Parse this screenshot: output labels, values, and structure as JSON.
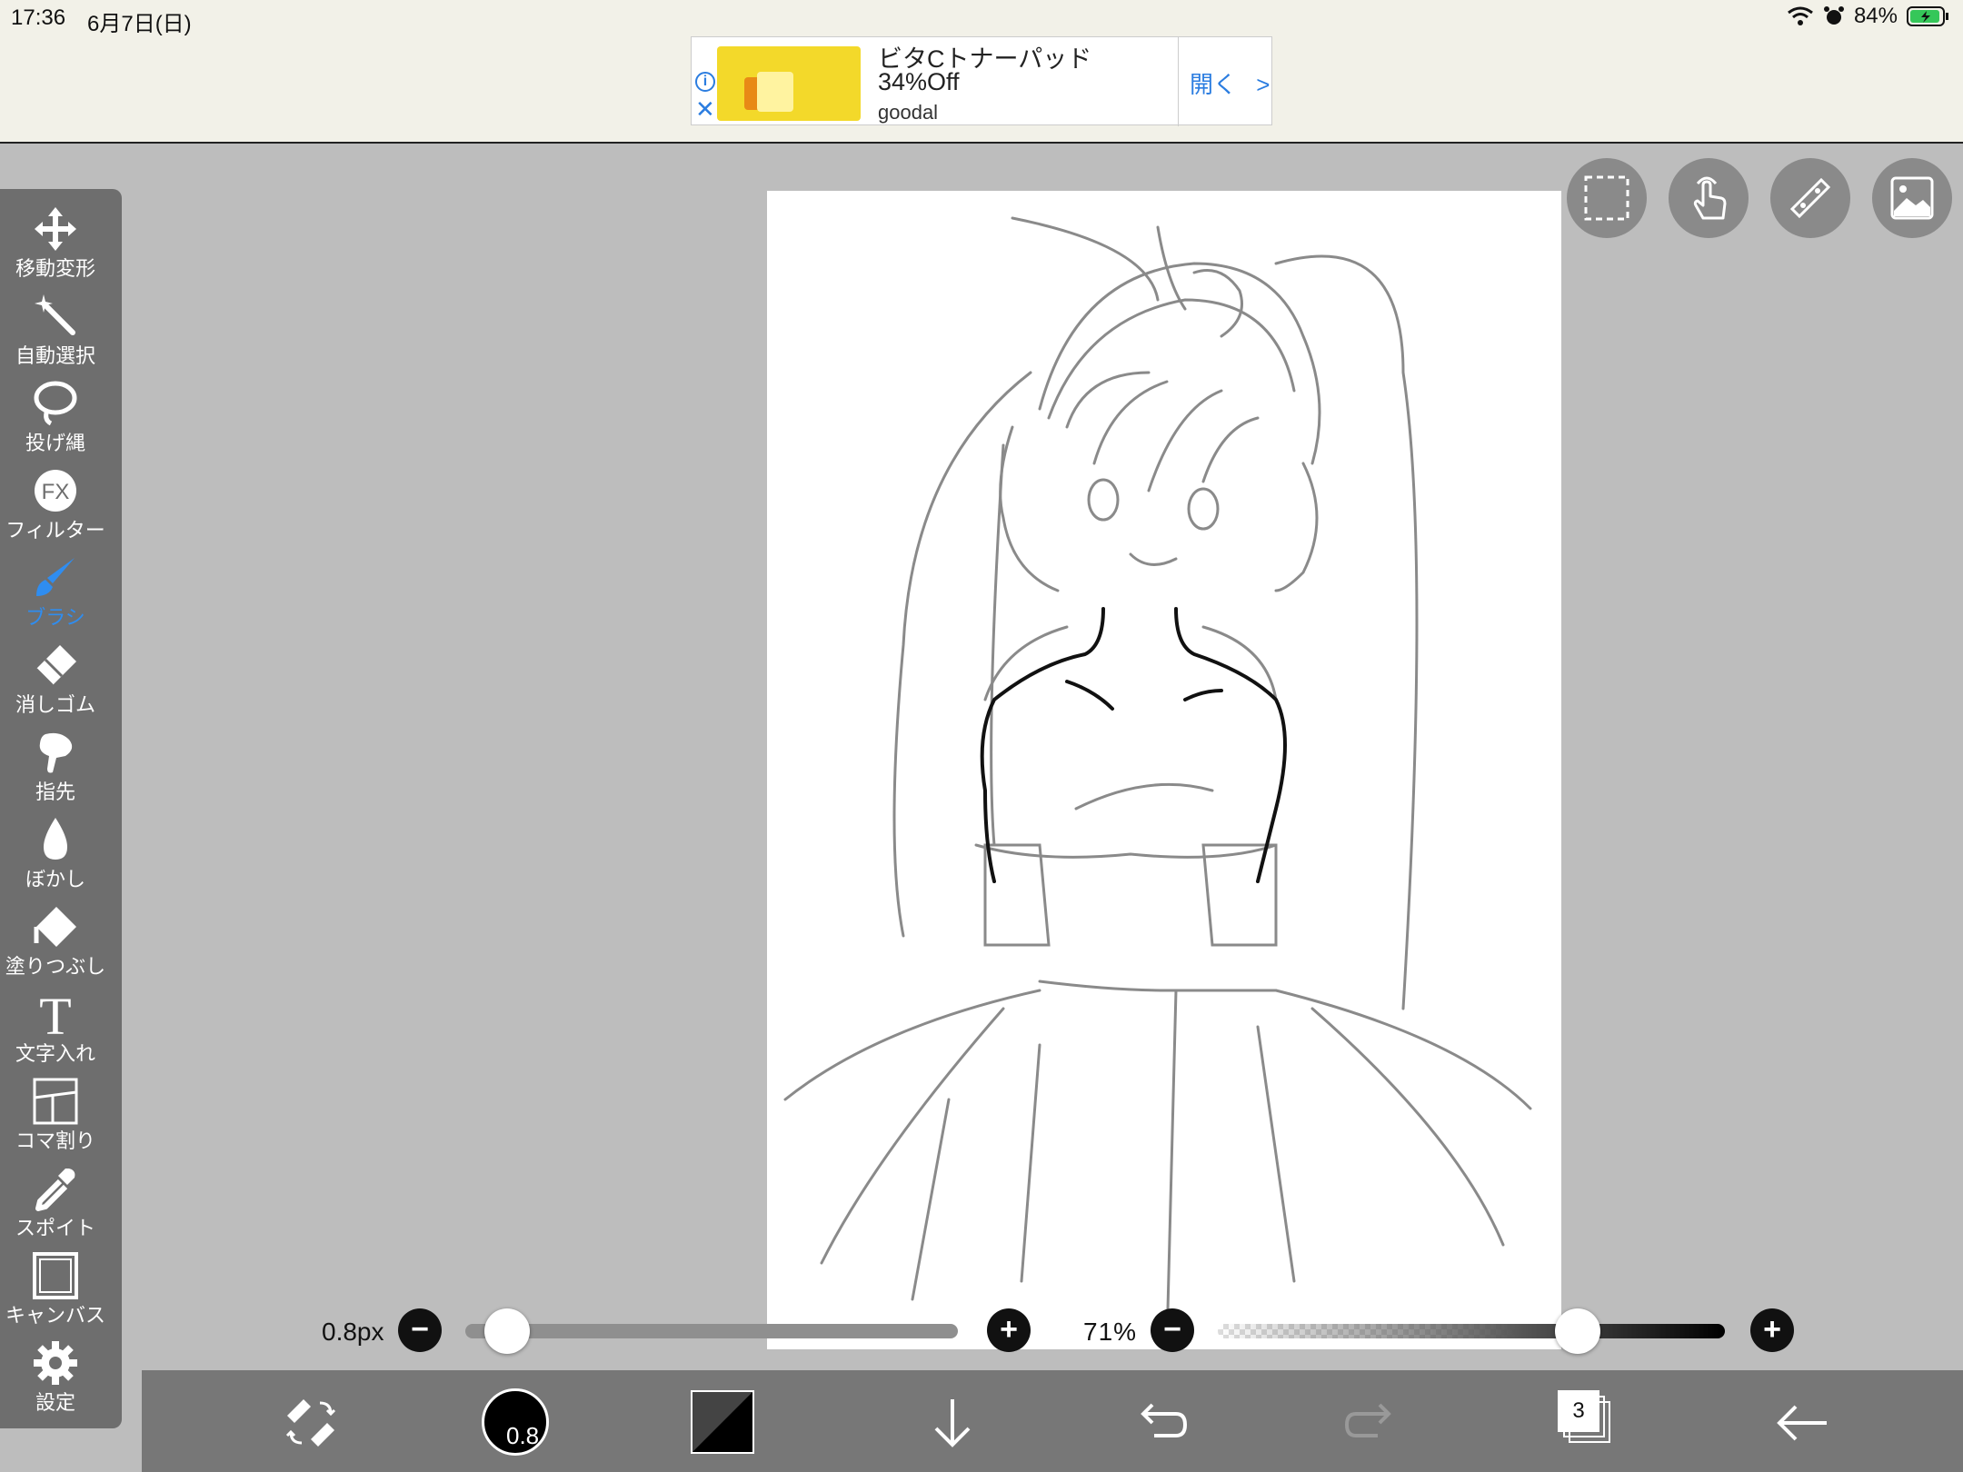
{
  "status": {
    "time": "17:36",
    "date": "6月7日(日)",
    "battery": "84%",
    "icons": [
      "wifi-icon",
      "alarm-icon",
      "battery-icon"
    ]
  },
  "ad": {
    "title": "ビタCトナーパッド",
    "subtitle": "34%Off",
    "brand": "goodal",
    "open_label": "開く",
    "info_icon": "info-icon",
    "close_icon": "close-icon"
  },
  "tools": [
    {
      "label": "移動変形",
      "icon": "move-icon"
    },
    {
      "label": "自動選択",
      "icon": "magic-wand-icon"
    },
    {
      "label": "投げ縄",
      "icon": "lasso-icon"
    },
    {
      "label": "フィルター",
      "icon": "fx-icon"
    },
    {
      "label": "ブラシ",
      "icon": "brush-icon"
    },
    {
      "label": "消しゴム",
      "icon": "eraser-icon"
    },
    {
      "label": "指先",
      "icon": "finger-icon"
    },
    {
      "label": "ぼかし",
      "icon": "blur-icon"
    },
    {
      "label": "塗りつぶし",
      "icon": "fill-icon"
    },
    {
      "label": "文字入れ",
      "icon": "text-icon"
    },
    {
      "label": "コマ割り",
      "icon": "panel-icon"
    },
    {
      "label": "スポイト",
      "icon": "eyedropper-icon"
    },
    {
      "label": "キャンバス",
      "icon": "canvas-icon"
    },
    {
      "label": "設定",
      "icon": "gear-icon"
    }
  ],
  "active_tool": "ブラシ",
  "quick_buttons": [
    "selection-icon",
    "touch-icon",
    "ruler-icon",
    "reference-image-icon"
  ],
  "brush": {
    "size_label": "0.8px",
    "size_value": 0.8,
    "opacity_label": "71%",
    "opacity_value": 0.71,
    "size_badge": "0.8",
    "minus": "−",
    "plus": "+"
  },
  "bottom": {
    "layer_count": "3",
    "icons": [
      "swap-tools-icon",
      "brush-size-icon",
      "color-icon",
      "download-icon",
      "undo-icon",
      "redo-icon",
      "layers-icon",
      "back-arrow-icon"
    ]
  },
  "colors": {
    "accent": "#2f8df0",
    "toolbar": "#6e6e6e",
    "workspace": "#bdbdbd",
    "bottombar": "#777777"
  }
}
